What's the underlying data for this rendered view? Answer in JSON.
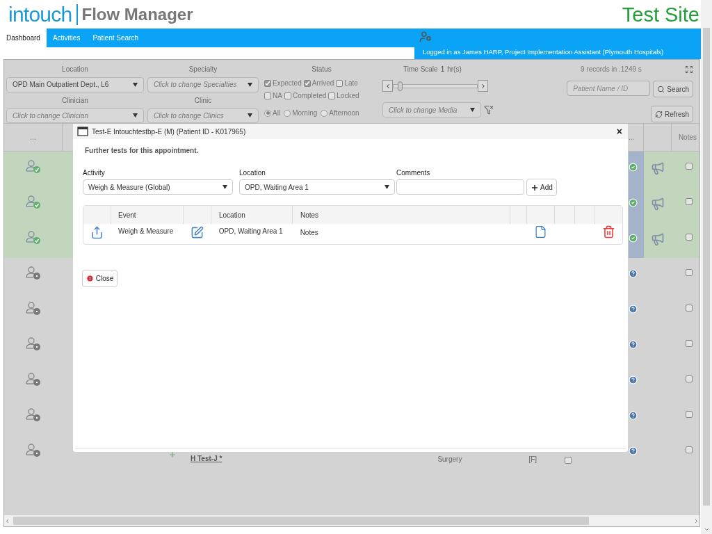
{
  "header": {
    "logo": "intouch",
    "app_name": "Flow Manager",
    "site": "Test Site"
  },
  "nav": {
    "tabs": [
      {
        "label": "Dashboard",
        "selected": true
      },
      {
        "label": "Activities",
        "selected": false
      },
      {
        "label": "Patient Search",
        "selected": false
      }
    ],
    "user": "Logged in as James HARP, Project Implementation Assistant (Plymouth Hospitals)"
  },
  "filters": {
    "location": {
      "label": "Location",
      "value": "OPD Main Outpatient Dept., L6"
    },
    "specialty": {
      "label": "Specialty",
      "placeholder": "Click to change Specialties"
    },
    "clinician": {
      "label": "Clinician",
      "placeholder": "Click to change Clinician"
    },
    "clinic": {
      "label": "Clinic",
      "placeholder": "Click to change Clinics"
    },
    "status": {
      "label": "Status",
      "options": [
        {
          "label": "Expected",
          "checked": true
        },
        {
          "label": "Arrived",
          "checked": true
        },
        {
          "label": "Late",
          "checked": false
        },
        {
          "label": "NA",
          "checked": false
        },
        {
          "label": "Completed",
          "checked": false
        },
        {
          "label": "Locked",
          "checked": false
        }
      ]
    },
    "session": [
      {
        "label": "All",
        "selected": true
      },
      {
        "label": "Morning",
        "selected": false
      },
      {
        "label": "Afternoon",
        "selected": false
      }
    ],
    "time_scale": {
      "label": "Time Scale",
      "value": "1",
      "unit": "hr(s)",
      "level": 0.05
    },
    "media": {
      "placeholder": "Click to change Media"
    },
    "records": "9 records in .1249 s",
    "patient_search": {
      "placeholder": "Patient Name / ID"
    },
    "search_button": "Search",
    "refresh_button": "Refresh"
  },
  "grid": {
    "columns": [
      "...",
      "...",
      "Notes"
    ],
    "rows": [
      {
        "kind": "arrived",
        "notes_checked": false
      },
      {
        "kind": "arrived",
        "notes_checked": false
      },
      {
        "kind": "arrived",
        "notes_checked": false
      },
      {
        "kind": "unknown",
        "notes_checked": false
      },
      {
        "kind": "unknown",
        "notes_checked": false
      },
      {
        "kind": "unknown",
        "notes_checked": false
      },
      {
        "kind": "unknown",
        "notes_checked": false
      },
      {
        "kind": "unknown",
        "notes_checked": false
      },
      {
        "kind": "unknown",
        "notes_checked": false,
        "patient": "H Test-J *",
        "specialty": "Surgery",
        "flag": "[F]",
        "checked": false
      }
    ]
  },
  "dialog": {
    "title": "Test-E Intouchtestbp-E (M) (Patient ID - K017965)",
    "close_symbol": "×",
    "heading": "Further tests for this appointment.",
    "activity": {
      "label": "Activity",
      "value": "Weigh & Measure (Global)"
    },
    "location": {
      "label": "Location",
      "value": "OPD, Waiting Area 1"
    },
    "comments": {
      "label": "Comments"
    },
    "add_button": "Add",
    "table": {
      "columns": [
        "Event",
        "Location",
        "Notes"
      ],
      "rows": [
        {
          "event": "Weigh & Measure",
          "location": "OPD, Waiting Area 1",
          "notes": "Notes"
        }
      ]
    },
    "close_button": "Close"
  }
}
